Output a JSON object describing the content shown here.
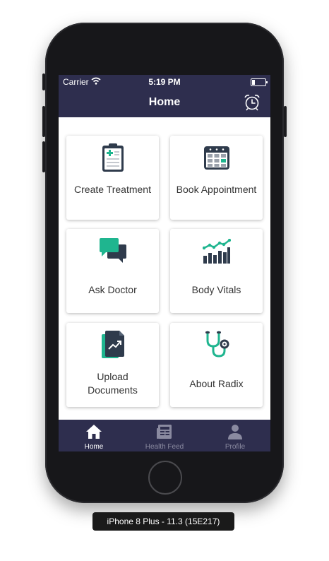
{
  "status_bar": {
    "carrier": "Carrier",
    "time": "5:19 PM"
  },
  "nav": {
    "title": "Home"
  },
  "tiles": [
    {
      "label": "Create Treatment"
    },
    {
      "label": "Book Appointment"
    },
    {
      "label": "Ask Doctor"
    },
    {
      "label": "Body Vitals"
    },
    {
      "label": "Upload Documents"
    },
    {
      "label": "About Radix"
    }
  ],
  "tabs": [
    {
      "label": "Home",
      "active": true
    },
    {
      "label": "Health Feed",
      "active": false
    },
    {
      "label": "Profile",
      "active": false
    }
  ],
  "device_caption": "iPhone 8 Plus - 11.3 (15E217)",
  "colors": {
    "bar": "#2e2e4e",
    "icon_dark": "#2f3b4c",
    "icon_accent": "#1fb58f",
    "tab_active": "#ffffff",
    "tab_inactive": "#8a8aa0"
  }
}
